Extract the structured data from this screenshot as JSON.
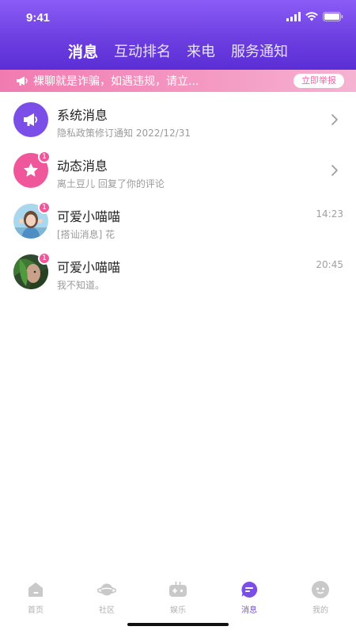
{
  "status_bar": {
    "time": "9:41"
  },
  "header": {
    "tabs": [
      {
        "label": "消息",
        "active": true
      },
      {
        "label": "互动排名",
        "active": false
      },
      {
        "label": "来电",
        "active": false
      },
      {
        "label": "服务通知",
        "active": false
      }
    ]
  },
  "notice": {
    "text": "裸聊就是诈骗，如遇违规，请立...",
    "report_label": "立即举报",
    "icon": "megaphone-icon"
  },
  "messages": [
    {
      "title": "系统消息",
      "subtitle": "隐私政策修订通知   2022/12/31",
      "icon": "megaphone-icon",
      "color": "#7b4ee8"
    },
    {
      "title": "动态消息",
      "subtitle": "离土豆儿 回复了你的评论",
      "badge": "1",
      "icon": "star-icon",
      "color": "#f0569a"
    },
    {
      "title": "可爱小喵喵",
      "subtitle": "[搭讪消息] 花",
      "badge": "1",
      "time": "14:23"
    },
    {
      "title": "可爱小喵喵",
      "subtitle": "我不知道。",
      "badge": "1",
      "time": "20:45"
    }
  ],
  "tabbar": {
    "items": [
      {
        "label": "首页",
        "icon": "home-icon"
      },
      {
        "label": "社区",
        "icon": "planet-icon"
      },
      {
        "label": "娱乐",
        "icon": "gamepad-icon"
      },
      {
        "label": "消息",
        "icon": "message-icon",
        "active": true
      },
      {
        "label": "我的",
        "icon": "profile-icon"
      }
    ]
  },
  "colors": {
    "accent": "#7b4ee8",
    "pink": "#f0569a",
    "header_top": "#8b5cf6",
    "header_bottom": "#5b2ed6"
  }
}
